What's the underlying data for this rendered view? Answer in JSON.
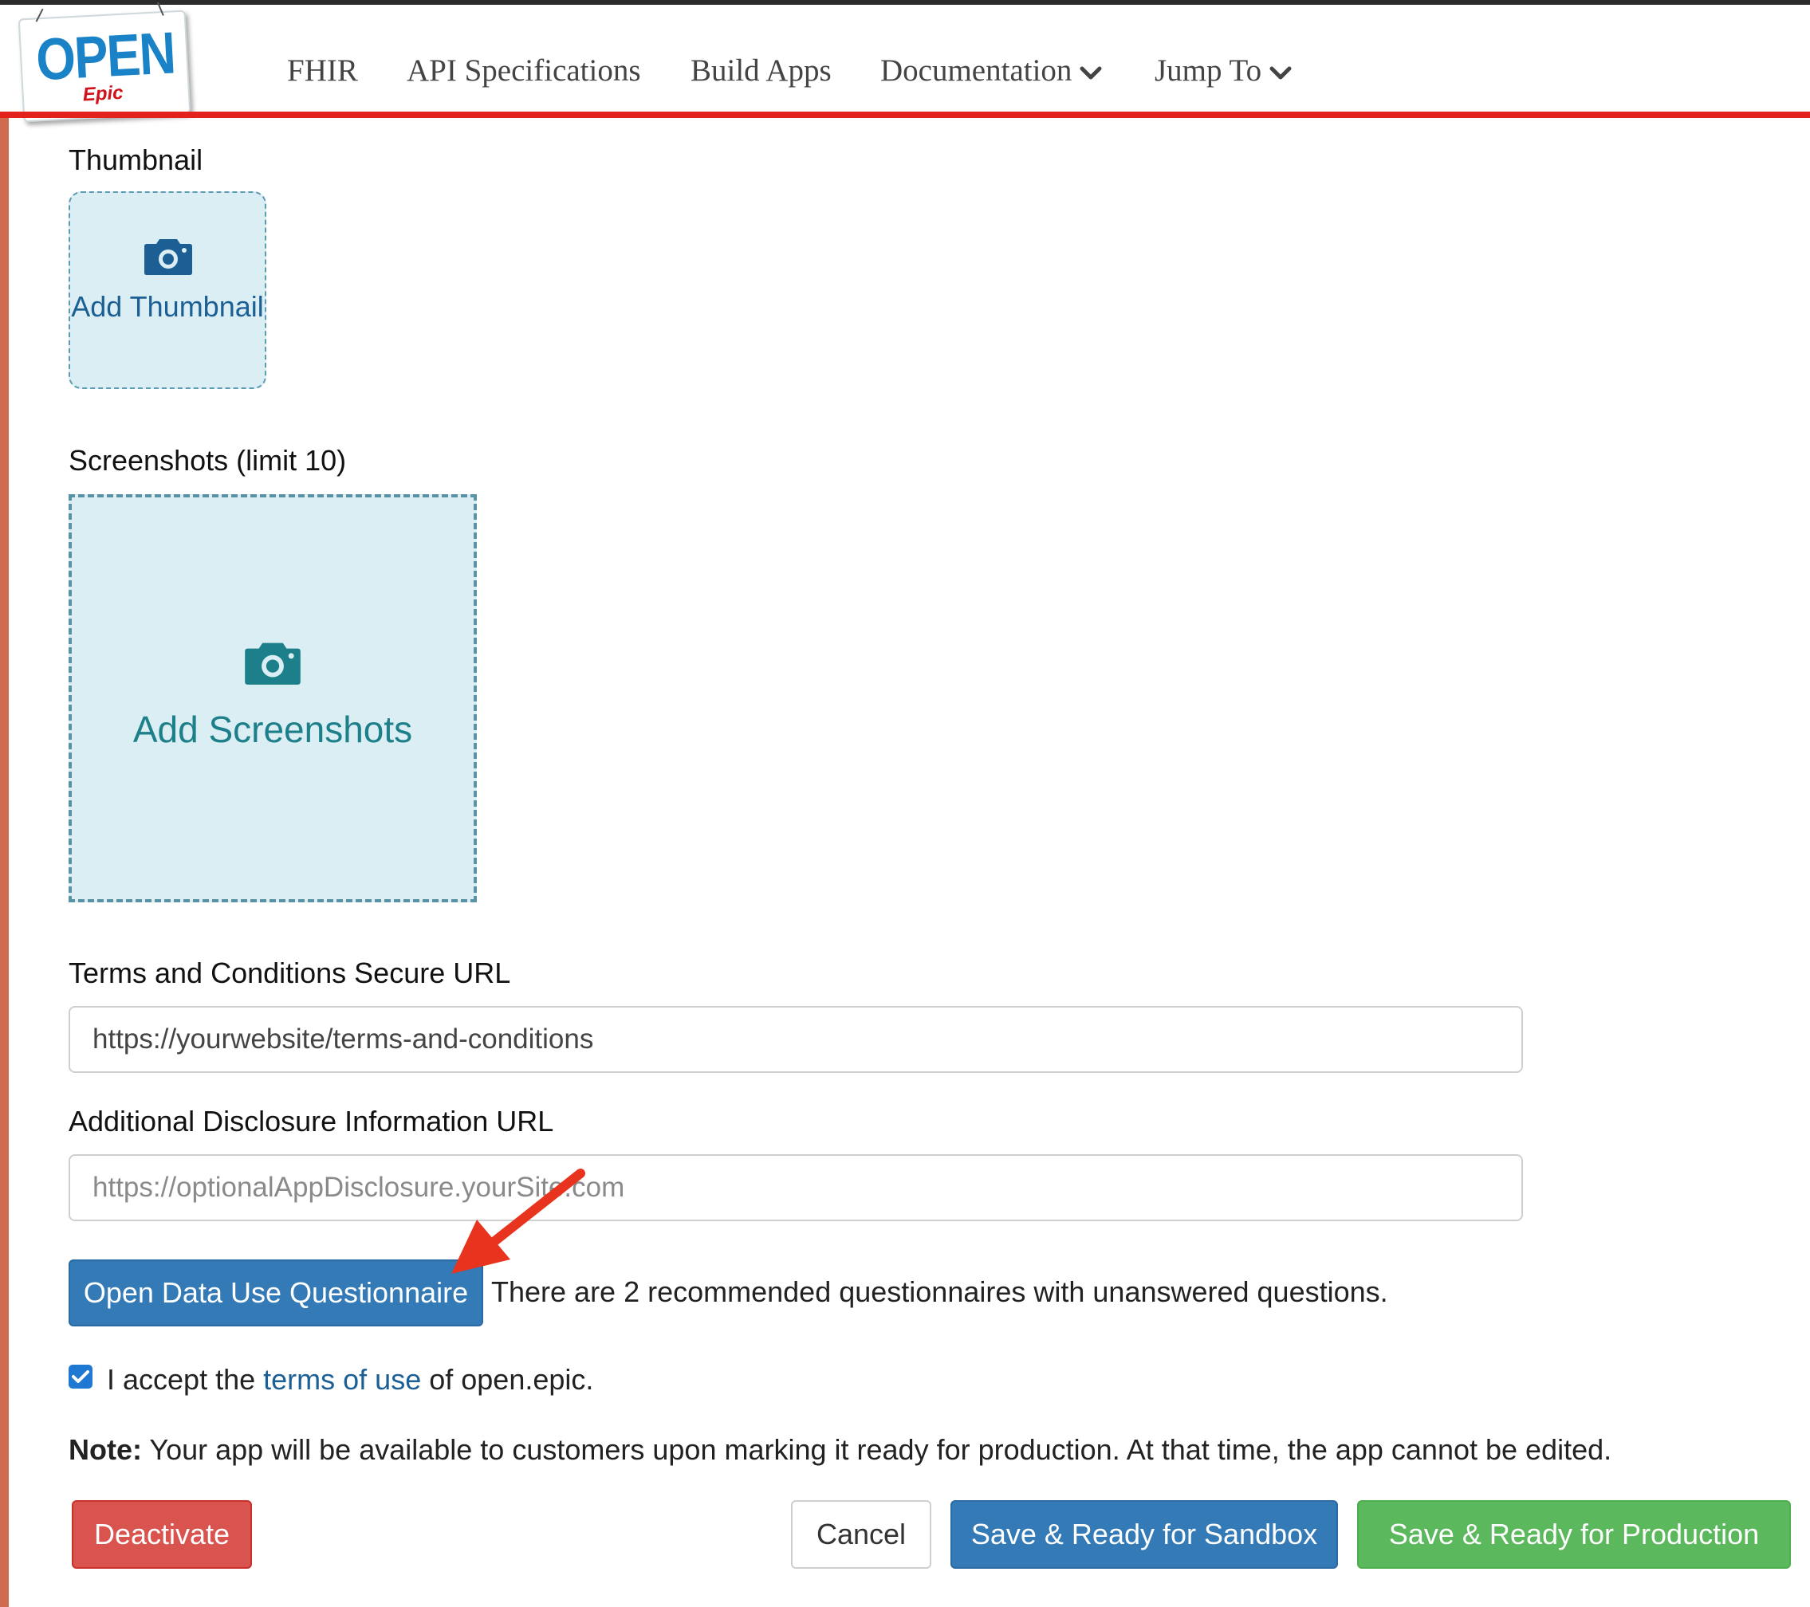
{
  "header": {
    "logo_text": "OPEN",
    "logo_subtext": "Epic",
    "nav": {
      "fhir": "FHIR",
      "api_specifications": "API Specifications",
      "build_apps": "Build Apps",
      "documentation": "Documentation",
      "jump_to": "Jump To"
    },
    "icons": {
      "dropdown": "chevron-down-icon"
    },
    "accent_color": "#e3231b"
  },
  "thumbnail": {
    "label": "Thumbnail",
    "add_text": "Add Thumbnail",
    "icon": "camera-icon"
  },
  "screenshots": {
    "label": "Screenshots (limit 10)",
    "add_text": "Add Screenshots",
    "icon": "camera-icon"
  },
  "terms_url": {
    "label": "Terms and Conditions Secure URL",
    "value": "https://yourwebsite/terms-and-conditions"
  },
  "disclosure_url": {
    "label": "Additional Disclosure Information URL",
    "placeholder": "https://optionalAppDisclosure.yourSite.com"
  },
  "questionnaire": {
    "button_label": "Open Data Use Questionnaire",
    "status_text": "There are 2 recommended questionnaires with unanswered questions.",
    "annotation": "red-arrow-icon"
  },
  "accept": {
    "checked": true,
    "prefix": "I accept the",
    "link_text": "terms of use",
    "suffix": "of open.epic."
  },
  "note": {
    "label": "Note:",
    "text": "Your app will be available to customers upon marking it ready for production. At that time, the app cannot be edited."
  },
  "actions": {
    "deactivate": "Deactivate",
    "cancel": "Cancel",
    "sandbox": "Save & Ready for Sandbox",
    "production": "Save & Ready for Production"
  },
  "colors": {
    "primary": "#337ab7",
    "danger": "#d9534f",
    "success": "#5cb85c",
    "upload_bg": "#daeef3"
  }
}
